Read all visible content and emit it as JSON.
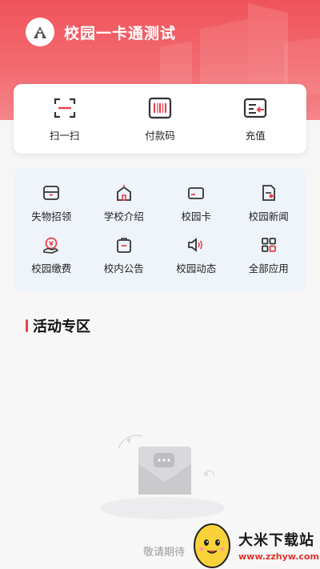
{
  "header": {
    "title": "校园一卡通测试",
    "logo_icon": "campus-logo-icon"
  },
  "colors": {
    "brand": "#f0535a",
    "accent": "#e8404a",
    "services_bg": "#eef4fa"
  },
  "quick_actions": [
    {
      "label": "扫一扫",
      "icon": "scan-icon"
    },
    {
      "label": "付款码",
      "icon": "barcode-icon"
    },
    {
      "label": "充值",
      "icon": "recharge-icon"
    }
  ],
  "services": [
    {
      "label": "失物招领",
      "icon": "lost-found-icon"
    },
    {
      "label": "学校介绍",
      "icon": "school-icon"
    },
    {
      "label": "校园卡",
      "icon": "card-icon"
    },
    {
      "label": "校园新闻",
      "icon": "news-icon"
    },
    {
      "label": "校园缴费",
      "icon": "payment-icon"
    },
    {
      "label": "校内公告",
      "icon": "notice-icon"
    },
    {
      "label": "校园动态",
      "icon": "speaker-icon"
    },
    {
      "label": "全部应用",
      "icon": "all-apps-icon"
    }
  ],
  "activity": {
    "title": "活动专区",
    "empty_text": "敬请期待"
  },
  "watermark": {
    "name": "大米下载站",
    "url": "www.zzhyw.com"
  }
}
